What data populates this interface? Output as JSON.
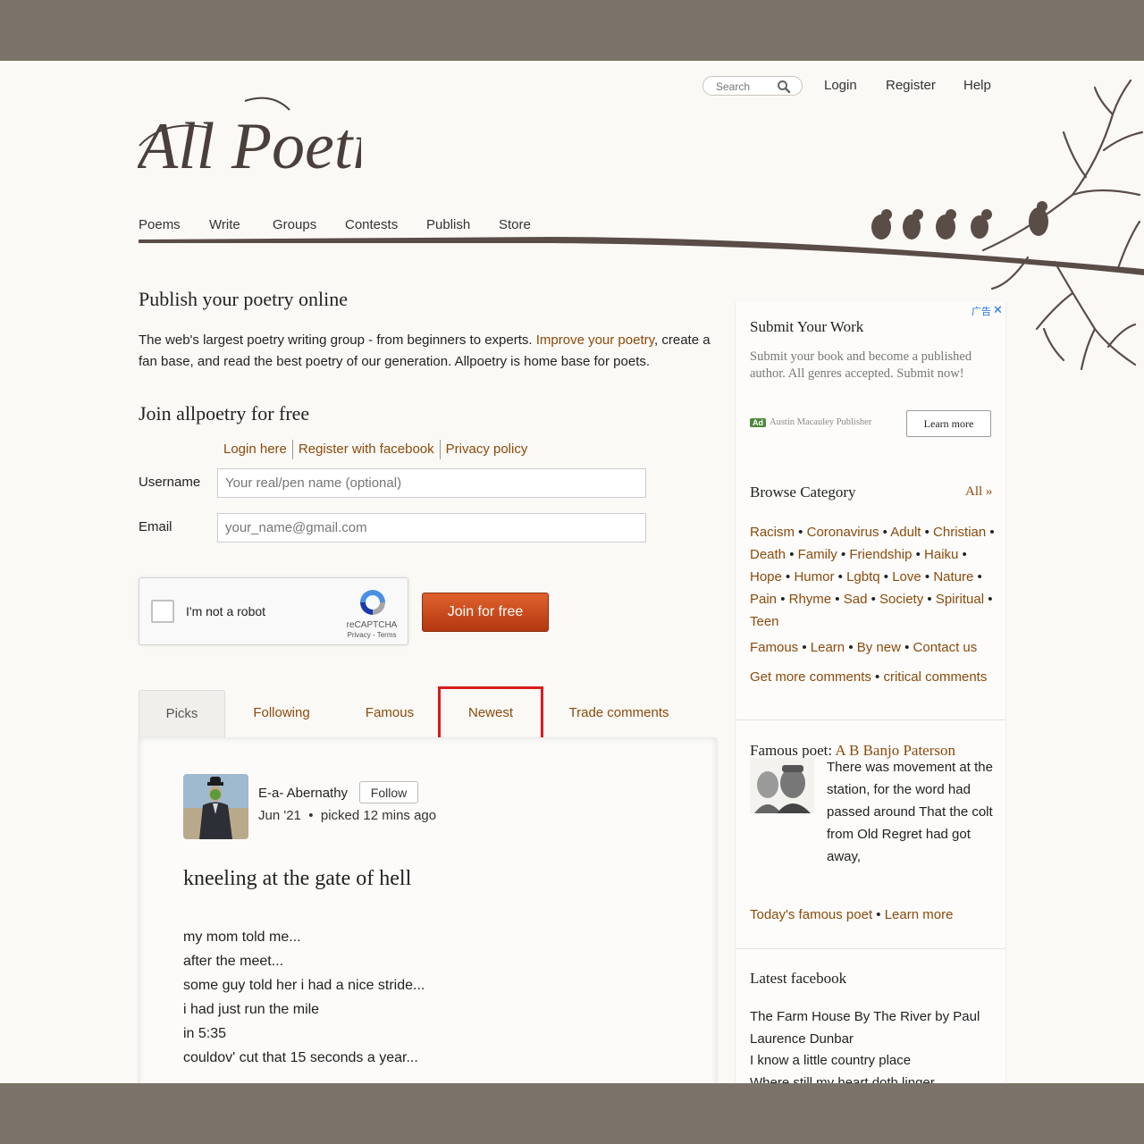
{
  "header": {
    "logo_text": "All Poetry",
    "search_placeholder": "Search",
    "links": [
      "Login",
      "Register",
      "Help"
    ]
  },
  "nav": [
    "Poems",
    "Write",
    "Groups",
    "Contests",
    "Publish",
    "Store"
  ],
  "intro": {
    "heading": "Publish your poetry online",
    "text_before": "The web's largest poetry writing group - from beginners to experts. ",
    "link": "Improve your poetry",
    "text_after": ", create a fan base, and read the best poetry of our generation. Allpoetry is home base for poets."
  },
  "join": {
    "heading": "Join allpoetry for free",
    "links": [
      "Login here",
      "Register with facebook",
      "Privacy policy"
    ],
    "username_label": "Username",
    "username_placeholder": "Your real/pen name (optional)",
    "email_label": "Email",
    "email_placeholder": "your_name@gmail.com",
    "captcha_label": "I'm not a robot",
    "captcha_brand": "reCAPTCHA",
    "captcha_links": "Privacy - Terms",
    "button": "Join for free"
  },
  "tabs": [
    "Picks",
    "Following",
    "Famous",
    "Newest",
    "Trade comments"
  ],
  "poem_card": {
    "author": "E-a- Abernathy",
    "follow": "Follow",
    "date": "Jun '21",
    "bullet": "•",
    "picked": "picked 12 mins ago",
    "title": "kneeling at the gate of hell",
    "lines": [
      "my mom told me...",
      "after the meet...",
      "some guy told her i had a nice stride...",
      "i had just run the mile",
      "in 5:35",
      "couldov' cut that 15 seconds a year..."
    ]
  },
  "ad": {
    "tag": "广告",
    "close": "✕",
    "title": "Submit Your Work",
    "desc": "Submit your book and become a published author. All genres accepted. Submit now!",
    "badge": "Ad",
    "advertiser": "Austin Macauley Publisher",
    "button": "Learn more"
  },
  "browse": {
    "heading": "Browse Category",
    "all": "All »",
    "categories": [
      "Racism",
      "Coronavirus",
      "Adult",
      "Christian",
      "Death",
      "Family",
      "Friendship",
      "Haiku",
      "Hope",
      "Humor",
      "Lgbtq",
      "Love",
      "Nature",
      "Pain",
      "Rhyme",
      "Sad",
      "Society",
      "Spiritual",
      "Teen"
    ],
    "extra1": [
      "Famous",
      "Learn",
      "By new",
      "Contact us"
    ],
    "extra2": [
      "Get more comments",
      "critical comments"
    ]
  },
  "famous_poet": {
    "label": "Famous poet:",
    "name": "A B Banjo Paterson",
    "excerpt": "There was movement at the station, for the word had passed around That the colt from Old Regret had got away,",
    "link1": "Today's famous poet",
    "link2": "Learn more"
  },
  "facebook": {
    "heading": "Latest facebook",
    "lines": [
      "The Farm House By The River by Paul Laurence Dunbar",
      "I know a little country place",
      "Where still my heart doth linger"
    ]
  }
}
